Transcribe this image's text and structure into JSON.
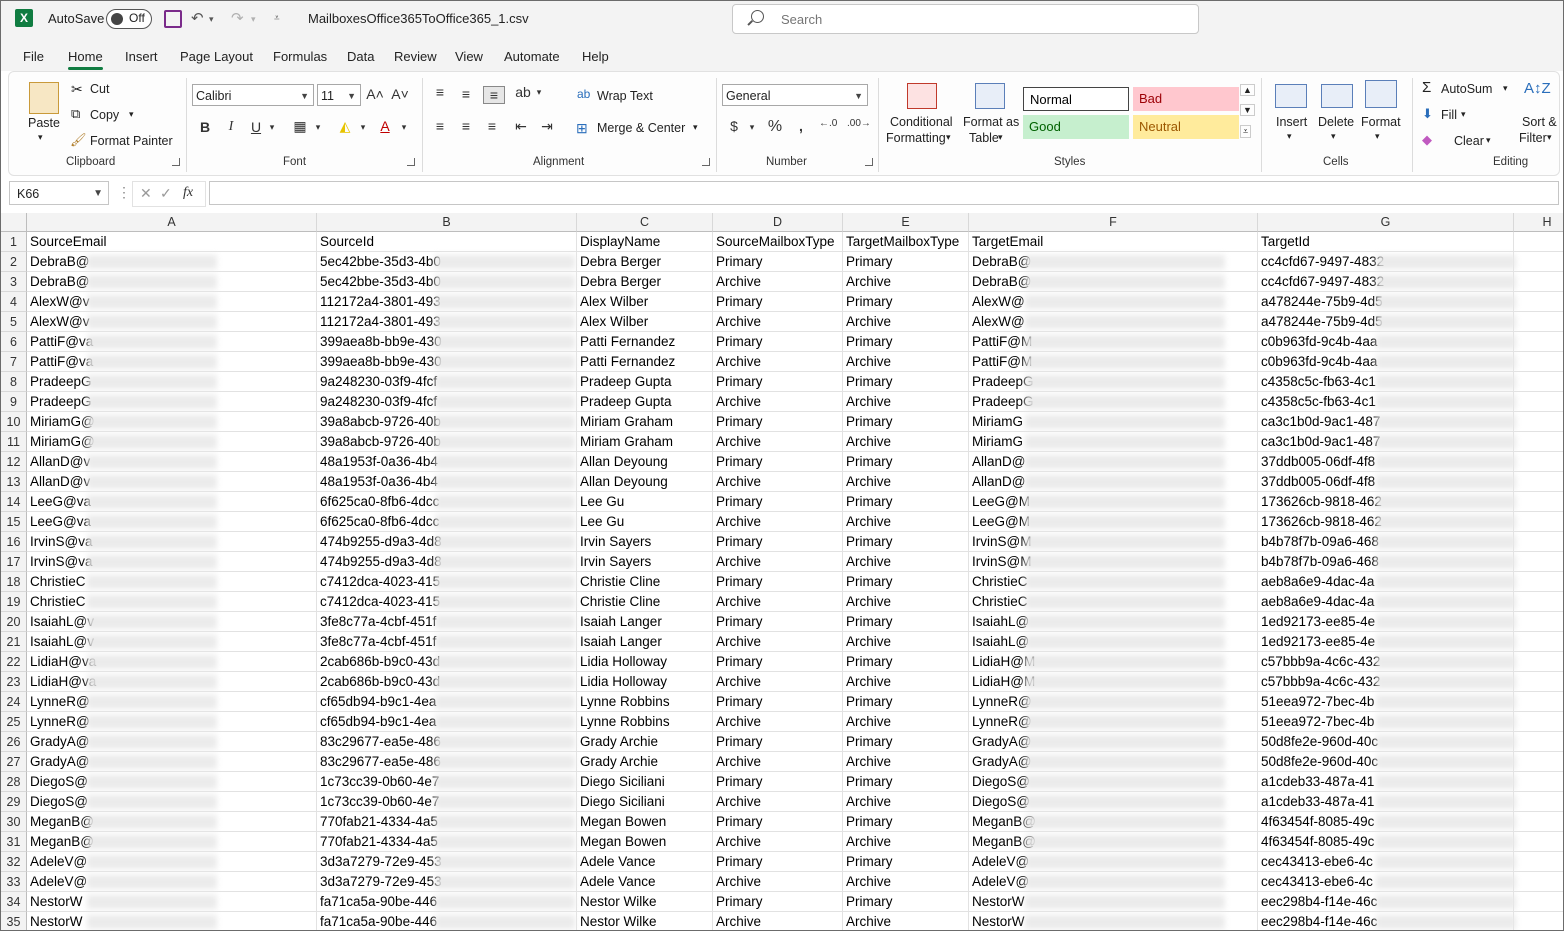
{
  "titlebar": {
    "autosave_label": "AutoSave",
    "autosave_state": "Off",
    "filename": "MailboxesOffice365ToOffice365_1.csv",
    "search_placeholder": "Search"
  },
  "menu": {
    "tabs": [
      "File",
      "Home",
      "Insert",
      "Page Layout",
      "Formulas",
      "Data",
      "Review",
      "View",
      "Automate",
      "Help"
    ],
    "active": "Home"
  },
  "ribbon": {
    "clipboard": {
      "label": "Clipboard",
      "paste": "Paste",
      "cut": "Cut",
      "copy": "Copy",
      "format_painter": "Format Painter"
    },
    "font": {
      "label": "Font",
      "family": "Calibri",
      "size": "11"
    },
    "alignment": {
      "label": "Alignment",
      "wrap_text": "Wrap Text",
      "merge_center": "Merge & Center"
    },
    "number": {
      "label": "Number",
      "format": "General"
    },
    "styles": {
      "label": "Styles",
      "conditional_line1": "Conditional",
      "conditional_line2": "Formatting",
      "format_table_line1": "Format as",
      "format_table_line2": "Table",
      "normal": "Normal",
      "bad": "Bad",
      "good": "Good",
      "neutral": "Neutral"
    },
    "cells": {
      "label": "Cells",
      "insert": "Insert",
      "delete": "Delete",
      "format": "Format"
    },
    "editing": {
      "label": "Editing",
      "autosum": "AutoSum",
      "fill": "Fill",
      "clear": "Clear",
      "sort_line1": "Sort &",
      "sort_line2": "Filter"
    }
  },
  "formula_bar": {
    "name_box": "K66",
    "fx": "fx",
    "formula": ""
  },
  "colors": {
    "excel_green": "#107c41",
    "bad_bg": "#ffc7ce",
    "bad_fg": "#9c0006",
    "good_bg": "#c6efce",
    "good_fg": "#006100",
    "neutral_bg": "#ffeb9c",
    "neutral_fg": "#9c5700"
  },
  "sheet": {
    "columns": [
      "A",
      "B",
      "C",
      "D",
      "E",
      "F",
      "G",
      "H"
    ],
    "header_row": [
      "SourceEmail",
      "SourceId",
      "DisplayName",
      "SourceMailboxType",
      "TargetMailboxType",
      "TargetEmail",
      "TargetId"
    ],
    "rows": [
      [
        "DebraB@",
        "5ec42bbe-35d3-4b0",
        "Debra Berger",
        "Primary",
        "Primary",
        "DebraB@",
        "cc4cfd67-9497-4832"
      ],
      [
        "DebraB@",
        "5ec42bbe-35d3-4b0",
        "Debra Berger",
        "Archive",
        "Archive",
        "DebraB@",
        "cc4cfd67-9497-4832"
      ],
      [
        "AlexW@v",
        "112172a4-3801-493",
        "Alex Wilber",
        "Primary",
        "Primary",
        "AlexW@",
        "a478244e-75b9-4d5"
      ],
      [
        "AlexW@v",
        "112172a4-3801-493",
        "Alex Wilber",
        "Archive",
        "Archive",
        "AlexW@",
        "a478244e-75b9-4d5"
      ],
      [
        "PattiF@va",
        "399aea8b-bb9e-430",
        "Patti Fernandez",
        "Primary",
        "Primary",
        "PattiF@M",
        "c0b963fd-9c4b-4aa"
      ],
      [
        "PattiF@va",
        "399aea8b-bb9e-430",
        "Patti Fernandez",
        "Archive",
        "Archive",
        "PattiF@M",
        "c0b963fd-9c4b-4aa"
      ],
      [
        "PradeepG",
        "9a248230-03f9-4fcf",
        "Pradeep Gupta",
        "Primary",
        "Primary",
        "PradeepG",
        "c4358c5c-fb63-4c1"
      ],
      [
        "PradeepG",
        "9a248230-03f9-4fcf",
        "Pradeep Gupta",
        "Archive",
        "Archive",
        "PradeepG",
        "c4358c5c-fb63-4c1"
      ],
      [
        "MiriamG@",
        "39a8abcb-9726-40b",
        "Miriam Graham",
        "Primary",
        "Primary",
        "MiriamG",
        "ca3c1b0d-9ac1-487"
      ],
      [
        "MiriamG@",
        "39a8abcb-9726-40b",
        "Miriam Graham",
        "Archive",
        "Archive",
        "MiriamG",
        "ca3c1b0d-9ac1-487"
      ],
      [
        "AllanD@v",
        "48a1953f-0a36-4b4",
        "Allan Deyoung",
        "Primary",
        "Primary",
        "AllanD@",
        "37ddb005-06df-4f8"
      ],
      [
        "AllanD@v",
        "48a1953f-0a36-4b4",
        "Allan Deyoung",
        "Archive",
        "Archive",
        "AllanD@",
        "37ddb005-06df-4f8"
      ],
      [
        "LeeG@va",
        "6f625ca0-8fb6-4dcc",
        "Lee Gu",
        "Primary",
        "Primary",
        "LeeG@M",
        "173626cb-9818-462"
      ],
      [
        "LeeG@va",
        "6f625ca0-8fb6-4dcc",
        "Lee Gu",
        "Archive",
        "Archive",
        "LeeG@M",
        "173626cb-9818-462"
      ],
      [
        "IrvinS@va",
        "474b9255-d9a3-4d8",
        "Irvin Sayers",
        "Primary",
        "Primary",
        "IrvinS@M",
        "b4b78f7b-09a6-468"
      ],
      [
        "IrvinS@va",
        "474b9255-d9a3-4d8",
        "Irvin Sayers",
        "Archive",
        "Archive",
        "IrvinS@M",
        "b4b78f7b-09a6-468"
      ],
      [
        "ChristieC",
        "c7412dca-4023-415",
        "Christie Cline",
        "Primary",
        "Primary",
        "ChristieC",
        "aeb8a6e9-4dac-4a"
      ],
      [
        "ChristieC",
        "c7412dca-4023-415",
        "Christie Cline",
        "Archive",
        "Archive",
        "ChristieC",
        "aeb8a6e9-4dac-4a"
      ],
      [
        "IsaiahL@v",
        "3fe8c77a-4cbf-451f",
        "Isaiah Langer",
        "Primary",
        "Primary",
        "IsaiahL@",
        "1ed92173-ee85-4e"
      ],
      [
        "IsaiahL@v",
        "3fe8c77a-4cbf-451f",
        "Isaiah Langer",
        "Archive",
        "Archive",
        "IsaiahL@",
        "1ed92173-ee85-4e"
      ],
      [
        "LidiaH@va",
        "2cab686b-b9c0-43d",
        "Lidia Holloway",
        "Primary",
        "Primary",
        "LidiaH@M",
        "c57bbb9a-4c6c-432"
      ],
      [
        "LidiaH@va",
        "2cab686b-b9c0-43d",
        "Lidia Holloway",
        "Archive",
        "Archive",
        "LidiaH@M",
        "c57bbb9a-4c6c-432"
      ],
      [
        "LynneR@",
        "cf65db94-b9c1-4ea",
        "Lynne Robbins",
        "Primary",
        "Primary",
        "LynneR@",
        "51eea972-7bec-4b"
      ],
      [
        "LynneR@",
        "cf65db94-b9c1-4ea",
        "Lynne Robbins",
        "Archive",
        "Archive",
        "LynneR@",
        "51eea972-7bec-4b"
      ],
      [
        "GradyA@",
        "83c29677-ea5e-486",
        "Grady Archie",
        "Primary",
        "Primary",
        "GradyA@",
        "50d8fe2e-960d-40c"
      ],
      [
        "GradyA@",
        "83c29677-ea5e-486",
        "Grady Archie",
        "Archive",
        "Archive",
        "GradyA@",
        "50d8fe2e-960d-40c"
      ],
      [
        "DiegoS@",
        "1c73cc39-0b60-4e7",
        "Diego Siciliani",
        "Primary",
        "Primary",
        "DiegoS@",
        "a1cdeb33-487a-41"
      ],
      [
        "DiegoS@",
        "1c73cc39-0b60-4e7",
        "Diego Siciliani",
        "Archive",
        "Archive",
        "DiegoS@",
        "a1cdeb33-487a-41"
      ],
      [
        "MeganB@",
        "770fab21-4334-4a5",
        "Megan Bowen",
        "Primary",
        "Primary",
        "MeganB@",
        "4f63454f-8085-49c"
      ],
      [
        "MeganB@",
        "770fab21-4334-4a5",
        "Megan Bowen",
        "Archive",
        "Archive",
        "MeganB@",
        "4f63454f-8085-49c"
      ],
      [
        "AdeleV@",
        "3d3a7279-72e9-453",
        "Adele Vance",
        "Primary",
        "Primary",
        "AdeleV@",
        "cec43413-ebe6-4c"
      ],
      [
        "AdeleV@",
        "3d3a7279-72e9-453",
        "Adele Vance",
        "Archive",
        "Archive",
        "AdeleV@",
        "cec43413-ebe6-4c"
      ],
      [
        "NestorW",
        "fa71ca5a-90be-446",
        "Nestor Wilke",
        "Primary",
        "Primary",
        "NestorW",
        "eec298b4-f14e-46c"
      ],
      [
        "NestorW",
        "fa71ca5a-90be-446",
        "Nestor Wilke",
        "Archive",
        "Archive",
        "NestorW",
        "eec298b4-f14e-46c"
      ]
    ]
  }
}
